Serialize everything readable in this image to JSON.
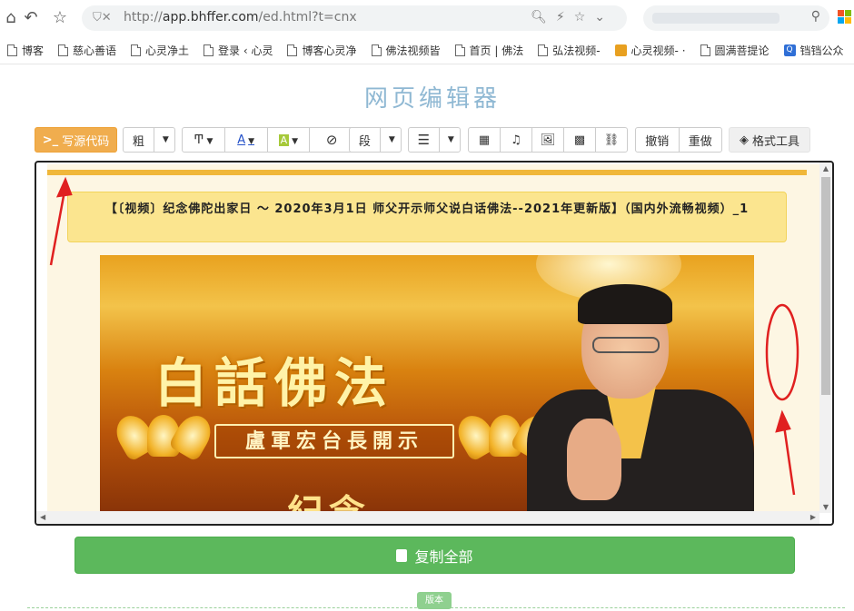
{
  "browser": {
    "url_prefix": "http://",
    "url_main": "app.bhffer.com",
    "url_rest": "/ed.html?t=cnx",
    "bookmarks": [
      {
        "label": "博客",
        "icon": "doc-icon"
      },
      {
        "label": "慈心善语",
        "icon": "doc-icon"
      },
      {
        "label": "心灵净土",
        "icon": "doc-icon"
      },
      {
        "label": "登录 ‹ 心灵",
        "icon": "doc-icon"
      },
      {
        "label": "博客心灵净",
        "icon": "doc-icon"
      },
      {
        "label": "佛法视频皆",
        "icon": "doc-icon"
      },
      {
        "label": "首页 | 佛法",
        "icon": "doc-icon"
      },
      {
        "label": "弘法视频-",
        "icon": "doc-icon"
      },
      {
        "label": "心灵视频- ·",
        "icon": "site-icon"
      },
      {
        "label": "圆满菩提论",
        "icon": "doc-icon"
      },
      {
        "label": "铛铛公众",
        "icon": "q-icon"
      }
    ]
  },
  "page": {
    "title": "网页编辑器"
  },
  "toolbar": {
    "source_label": "写源代码",
    "bold_label": "粗",
    "paragraph_label": "段",
    "undo_label": "撤销",
    "redo_label": "重做",
    "format_label": "格式工具"
  },
  "editor": {
    "article_title": "【〔视频〕纪念佛陀出家日 ～ 2020年3月1日 师父开示师父说白话佛法--2021年更新版】（国内外流畅视频）_1",
    "banner_title": "白話佛法",
    "banner_subtitle": "盧軍宏台長開示",
    "banner_cut_text": "紀念"
  },
  "actions": {
    "copy_all_label": "复制全部",
    "version_label": "版本"
  },
  "colors": {
    "source_button": "#f0ad4e",
    "copy_button": "#5cb85c",
    "title_box": "#fbe58f",
    "gold_bar": "#f0b73a",
    "annotation": "#e02020"
  }
}
